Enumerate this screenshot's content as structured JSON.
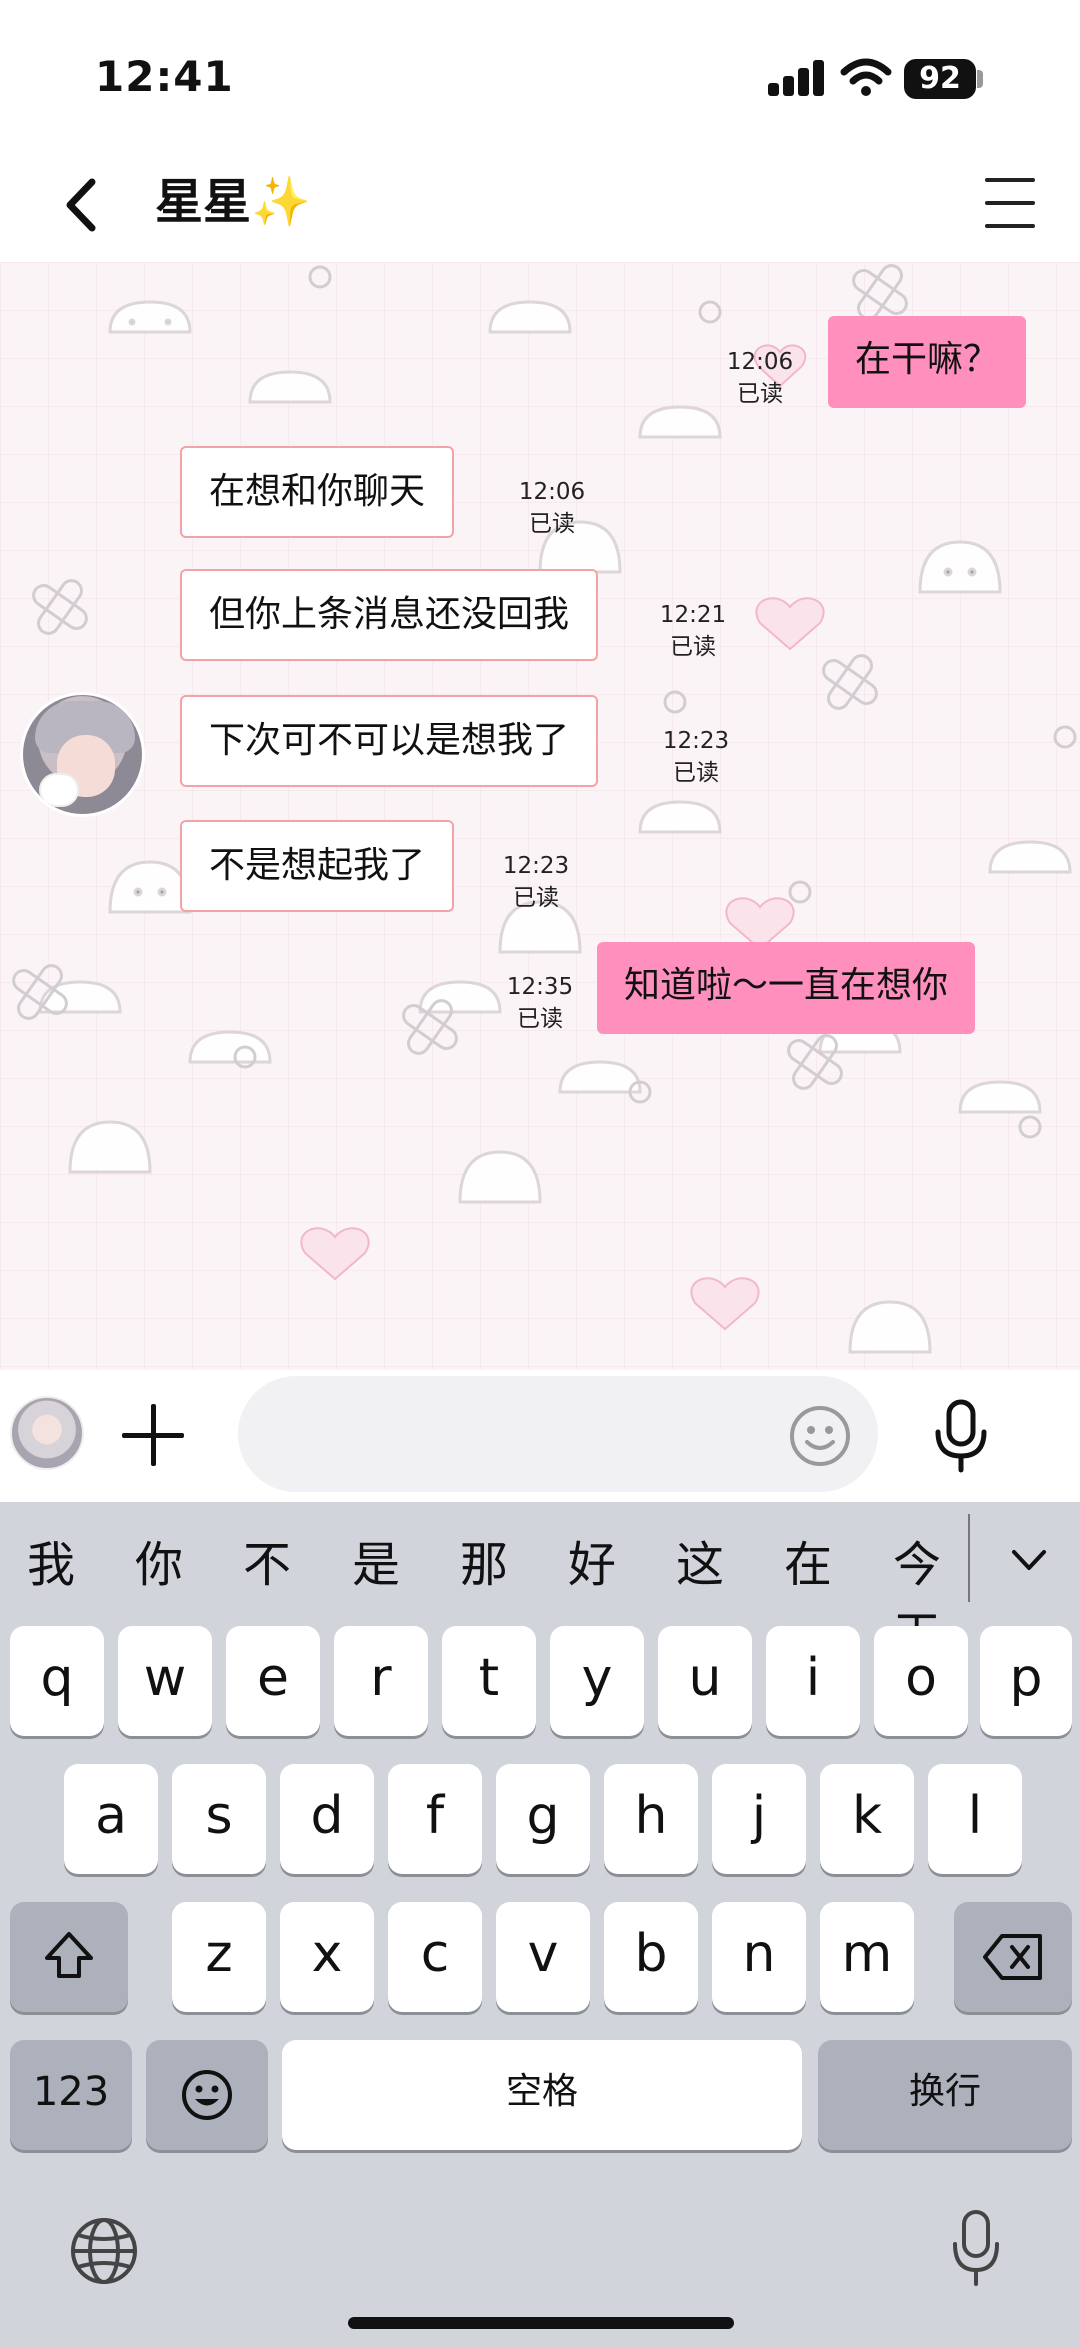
{
  "status_bar": {
    "time": "12:41",
    "battery": "92"
  },
  "header": {
    "back_icon": "chevron-left-icon",
    "contact_name": "星星✨",
    "menu_icon": "hamburger-menu-icon"
  },
  "messages": [
    {
      "side": "out",
      "text": "在干嘛？",
      "time": "12:06",
      "status": "已读"
    },
    {
      "side": "in",
      "text": "在想和你聊天",
      "time": "12:06",
      "status": "已读"
    },
    {
      "side": "in",
      "text": "但你上条消息还没回我",
      "time": "12:21",
      "status": "已读"
    },
    {
      "side": "in",
      "text": "下次可不可以是想我了",
      "time": "12:23",
      "status": "已读"
    },
    {
      "side": "in",
      "text": "不是想起我了",
      "time": "12:23",
      "status": "已读"
    },
    {
      "side": "out",
      "text": "知道啦～一直在想你",
      "time": "12:35",
      "status": "已读"
    }
  ],
  "input_bar": {
    "placeholder": "",
    "plus_icon": "plus-icon",
    "emoji_icon": "smiley-icon",
    "voice_icon": "microphone-icon"
  },
  "keyboard": {
    "candidates": [
      "我",
      "你",
      "不",
      "是",
      "那",
      "好",
      "这",
      "在",
      "今天"
    ],
    "expand_icon": "chevron-down-icon",
    "row1": [
      "q",
      "w",
      "e",
      "r",
      "t",
      "y",
      "u",
      "i",
      "o",
      "p"
    ],
    "row2": [
      "a",
      "s",
      "d",
      "f",
      "g",
      "h",
      "j",
      "k",
      "l"
    ],
    "row3": [
      "z",
      "x",
      "c",
      "v",
      "b",
      "n",
      "m"
    ],
    "shift_icon": "shift-icon",
    "delete_icon": "backspace-icon",
    "numbers_key": "123",
    "emoji_key_icon": "emoji-icon",
    "space_key": "空格",
    "return_key": "换行",
    "globe_icon": "globe-icon",
    "dictation_icon": "microphone-icon"
  },
  "colors": {
    "outgoing_bubble": "#ff8fbd",
    "incoming_border": "#f2a3a8",
    "chat_background": "#fbf4f6",
    "keyboard_background": "#d2d4db"
  }
}
